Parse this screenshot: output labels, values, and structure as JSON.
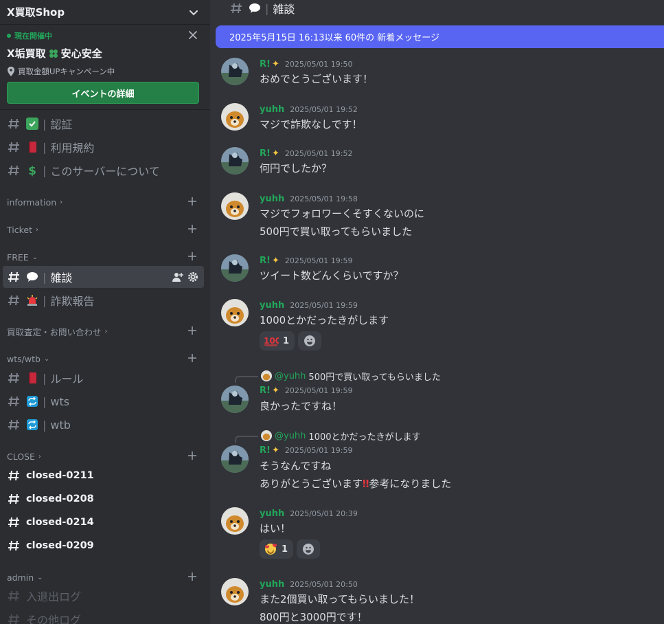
{
  "server": {
    "name": "X買取Shop"
  },
  "event": {
    "live_label": "現在開催中",
    "title": "X垢買取",
    "title_suffix": "安心安全",
    "location": "買取金額UPキャンペーン中",
    "button_label": "イベントの詳細"
  },
  "channels": {
    "verify": "認証",
    "rules": "利用規約",
    "about": "このサーバーについて",
    "chat": "雑談",
    "fraud": "詐欺報告",
    "rule2": "ルール",
    "wts": "wts",
    "wtb": "wtb",
    "closed1": "closed-0211",
    "closed2": "closed-0208",
    "closed3": "closed-0214",
    "closed4": "closed-0209",
    "log1": "入退出ログ",
    "log2": "その他ログ"
  },
  "categories": {
    "information": "information",
    "ticket": "Ticket",
    "free": "FREE",
    "kaitori": "買取査定・お問い合わせ",
    "wts": "wts/wtb",
    "close": "CLOSE",
    "admin": "admin"
  },
  "header": {
    "channel_name": "雑談"
  },
  "banner": {
    "text": "2025年5月15日 16:13以来 60件の 新着メッセージ"
  },
  "users": {
    "r": "R!",
    "yuhh": "yuhh"
  },
  "messages": [
    {
      "ts": "2025/05/01 19:50",
      "lines": [
        "おめでとうございます！"
      ]
    },
    {
      "ts": "2025/05/01 19:52",
      "lines": [
        "マジで詐欺なしです！"
      ]
    },
    {
      "ts": "2025/05/01 19:52",
      "lines": [
        "何円でしたか？"
      ]
    },
    {
      "ts": "2025/05/01 19:58",
      "lines": [
        "マジでフォロワーくそすくないのに",
        "500円で買い取ってもらいました"
      ]
    },
    {
      "ts": "2025/05/01 19:59",
      "lines": [
        "ツイート数どんくらいですか？"
      ]
    },
    {
      "ts": "2025/05/01 19:59",
      "lines": [
        "1000とかだったきがします"
      ],
      "reaction_count": "1"
    },
    {
      "ts": "2025/05/01 19:59",
      "lines": [
        "良かったですね！"
      ],
      "reply_user": "@yuhh",
      "reply_text": "500円で買い取ってもらいました"
    },
    {
      "ts": "2025/05/01 19:59",
      "lines": [
        "そうなんですね",
        "ありがとうございます",
        "参考になりました"
      ],
      "reply_user": "@yuhh",
      "reply_text": "1000とかだったきがします"
    },
    {
      "ts": "2025/05/01 20:39",
      "lines": [
        "はい！"
      ],
      "reaction_count": "1"
    },
    {
      "ts": "2025/05/01 20:50",
      "lines": [
        "また2個買い取ってもらいました！",
        "800円と3000円です！"
      ]
    }
  ],
  "colors": {
    "accent": "#5865f2",
    "green": "#23a55a",
    "sidebar": "#2b2d31",
    "main": "#313338"
  },
  "icons": {
    "verify": "check-mark-icon",
    "rules": "red-book-icon",
    "about": "dollar-icon",
    "chat": "speech-bubble-icon",
    "fraud": "siren-icon",
    "wts": "repeat-icon",
    "react1": "hundred-points-icon",
    "react2": "smiling-face-with-hearts-icon"
  }
}
